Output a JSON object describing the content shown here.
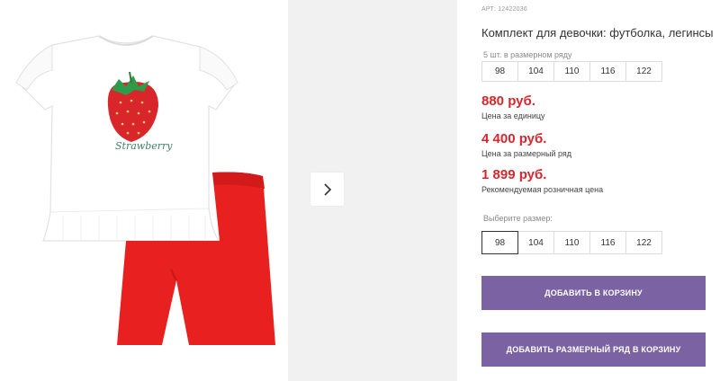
{
  "product": {
    "article": "АРТ: 12422036",
    "title": "Комплект для девочки: футболка, легинсы",
    "print_text": "Strawberry"
  },
  "size_row": {
    "caption": "5 шт. в размерном ряду",
    "sizes": [
      "98",
      "104",
      "110",
      "116",
      "122"
    ]
  },
  "prices": [
    {
      "value": "880 руб.",
      "caption": "Цена за единицу"
    },
    {
      "value": "4 400 руб.",
      "caption": "Цена за размерный ряд"
    },
    {
      "value": "1 899 руб.",
      "caption": "Рекомендуемая розничная цена"
    }
  ],
  "size_select": {
    "caption": "Выберите размер:",
    "options": [
      "98",
      "104",
      "110",
      "116",
      "122"
    ],
    "selected": "98"
  },
  "buttons": {
    "add_to_cart": "ДОБАВИТЬ В КОРЗИНУ",
    "add_size_row": "ДОБАВИТЬ РАЗМЕРНЫЙ РЯД В КОРЗИНУ"
  },
  "colors": {
    "price": "#d7262d",
    "button": "#7b63a3",
    "leggings": "#e8201f"
  },
  "icons": {
    "gallery_next": "chevron-right-icon"
  }
}
